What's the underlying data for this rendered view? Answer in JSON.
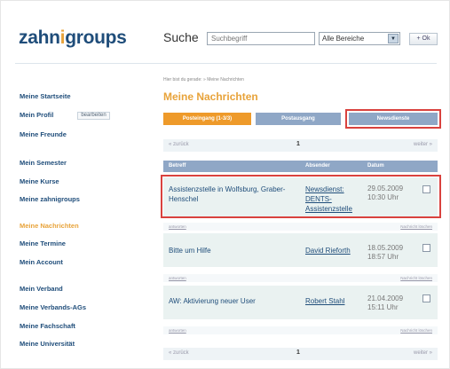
{
  "header": {
    "logo_part1": "zahn",
    "logo_tooth": "i",
    "logo_part2": "groups",
    "search_label": "Suche",
    "search_placeholder": "Suchbegriff",
    "area_selected": "Alle Bereiche",
    "dropdown_arrow": "▼",
    "ok_label": "+ Ok"
  },
  "sidebar": {
    "items": [
      {
        "label": "Meine Startseite"
      },
      {
        "label": "Mein Profil"
      },
      {
        "label": "Meine Freunde"
      },
      {
        "label": "Mein Semester"
      },
      {
        "label": "Meine Kurse"
      },
      {
        "label": "Meine zahnigroups"
      },
      {
        "label": "Meine Nachrichten"
      },
      {
        "label": "Meine Termine"
      },
      {
        "label": "Mein Account"
      },
      {
        "label": "Mein Verband"
      },
      {
        "label": "Meine Verbands-AGs"
      },
      {
        "label": "Meine Fachschaft"
      },
      {
        "label": "Meine Universität"
      }
    ],
    "edit_label": "bearbeiten"
  },
  "main": {
    "breadcrumb": "Hier bist du gerade:  » Meine Nachrichten",
    "title": "Meine Nachrichten",
    "tabs": [
      {
        "label": "Posteingang (1-3/3)"
      },
      {
        "label": "Postausgang"
      },
      {
        "label": "Newsdienste"
      }
    ],
    "pager": {
      "back": "« zurück",
      "page": "1",
      "next": "weiter »"
    },
    "columns": [
      "Betreff",
      "Absender",
      "Datum"
    ],
    "messages": [
      {
        "subject": "Assistenzstelle in Wolfsburg, Graber-Henschel",
        "sender": "Newsdienst: DENTS-Assistenzstelle",
        "date": "29.05.2009",
        "time": "10:30 Uhr"
      },
      {
        "subject": "Bitte um Hilfe",
        "sender": "David Rieforth",
        "date": "18.05.2009",
        "time": "18:57 Uhr"
      },
      {
        "subject": "AW: Aktivierung neuer User",
        "sender": "Robert Stahl",
        "date": "21.04.2009",
        "time": "15:11 Uhr"
      }
    ],
    "reply_label": "antworten",
    "delete_label": "Nachricht löschen"
  },
  "colors": {
    "brand_blue": "#1f4d7a",
    "accent_orange": "#e8a33a",
    "tab_blue": "#8fa7c6",
    "highlight_red": "#d9423e"
  }
}
